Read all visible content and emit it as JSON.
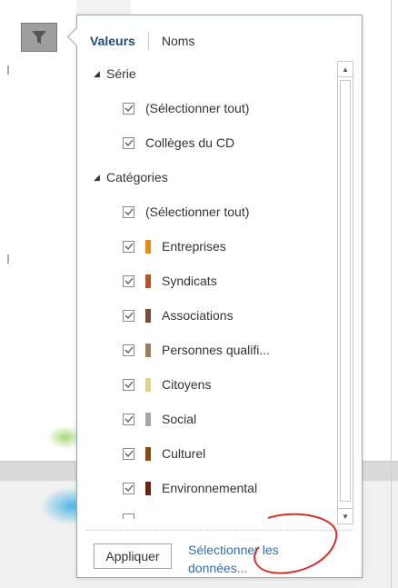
{
  "popup": {
    "tabs": [
      {
        "label": "Valeurs",
        "active": true
      },
      {
        "label": "Noms",
        "active": false
      }
    ],
    "sections": [
      {
        "label": "Série",
        "expanded": true
      },
      {
        "label": "Catégories",
        "expanded": true
      }
    ],
    "series_items": [
      {
        "label": "(Sélectionner tout)",
        "checked": true
      },
      {
        "label": "Collèges du CD",
        "checked": true
      }
    ],
    "category_items": [
      {
        "label": "(Sélectionner tout)",
        "checked": true,
        "color": null
      },
      {
        "label": "Entreprises",
        "checked": true,
        "color": "#e58a1f"
      },
      {
        "label": "Syndicats",
        "checked": true,
        "color": "#b5542a"
      },
      {
        "label": "Associations",
        "checked": true,
        "color": "#7a4a3a"
      },
      {
        "label": "Personnes qualifi...",
        "checked": true,
        "color": "#9a7f5a"
      },
      {
        "label": "Citoyens",
        "checked": true,
        "color": "#e0d28a"
      },
      {
        "label": "Social",
        "checked": true,
        "color": "#a8a8a8"
      },
      {
        "label": "Culturel",
        "checked": true,
        "color": "#8a4a14"
      },
      {
        "label": "Environnemental",
        "checked": true,
        "color": "#6b2410"
      }
    ],
    "apply_label": "Appliquer",
    "select_data_label": "Sélectionner les données..."
  },
  "colors": {
    "accent": "#1f4e79",
    "link": "#2e6db4",
    "annotation": "#d9302c"
  },
  "icons": {
    "filter": "funnel-icon",
    "collapse": "triangle-down-icon",
    "check": "checkmark-icon",
    "scroll_up": "chevron-up-icon",
    "scroll_down": "chevron-down-icon"
  }
}
